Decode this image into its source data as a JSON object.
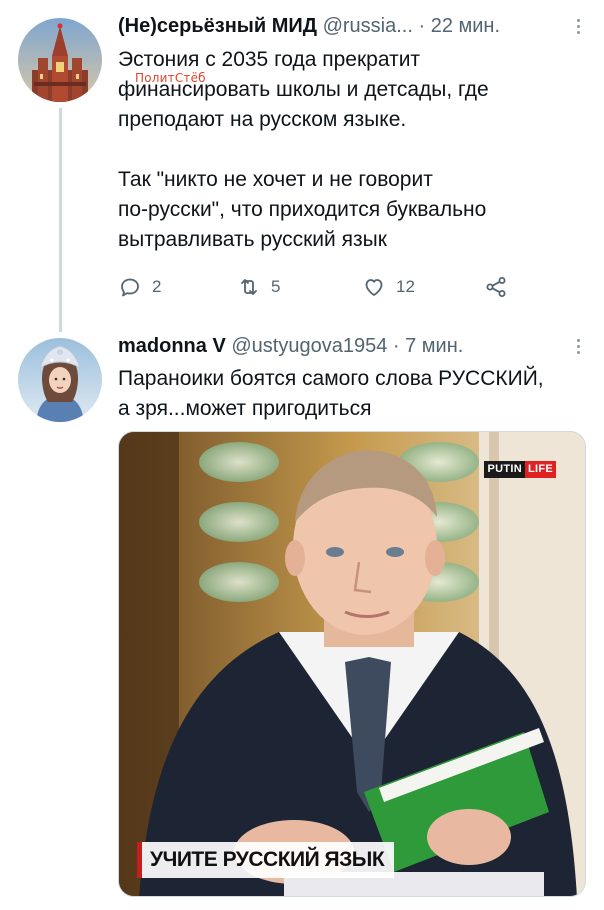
{
  "tweets": [
    {
      "name": "(Не)серьёзный МИД",
      "handle": "@russia...",
      "time": "22 мин.",
      "text": "Эстония с 2035 года прекратит\nфинансировать школы и детсады, где\nпреподают на русском языке.\n\nТак \"никто не хочет и не говорит\nпо-русски\", что приходится буквально\nвытравливать русский язык",
      "watermark": "ПолитСтёб",
      "actions": {
        "replies": "2",
        "retweets": "5",
        "likes": "12"
      }
    },
    {
      "name": "madonna V",
      "handle": "@ustyugova1954",
      "time": "7 мин.",
      "text": "Параноики боятся самого слова РУССКИЙ,\nа зря...может пригодиться",
      "media": {
        "brand_part1": "PUTIN",
        "brand_part2": "LIFE",
        "caption": "УЧИТЕ РУССКИЙ ЯЗЫК"
      }
    }
  ],
  "separator": "·",
  "icons": {
    "reply": "reply-icon",
    "retweet": "retweet-icon",
    "like": "heart-icon",
    "share": "share-icon",
    "more": "more-icon"
  },
  "colors": {
    "muted": "#536471",
    "line": "#cfd9de",
    "accent": "#e02121"
  }
}
